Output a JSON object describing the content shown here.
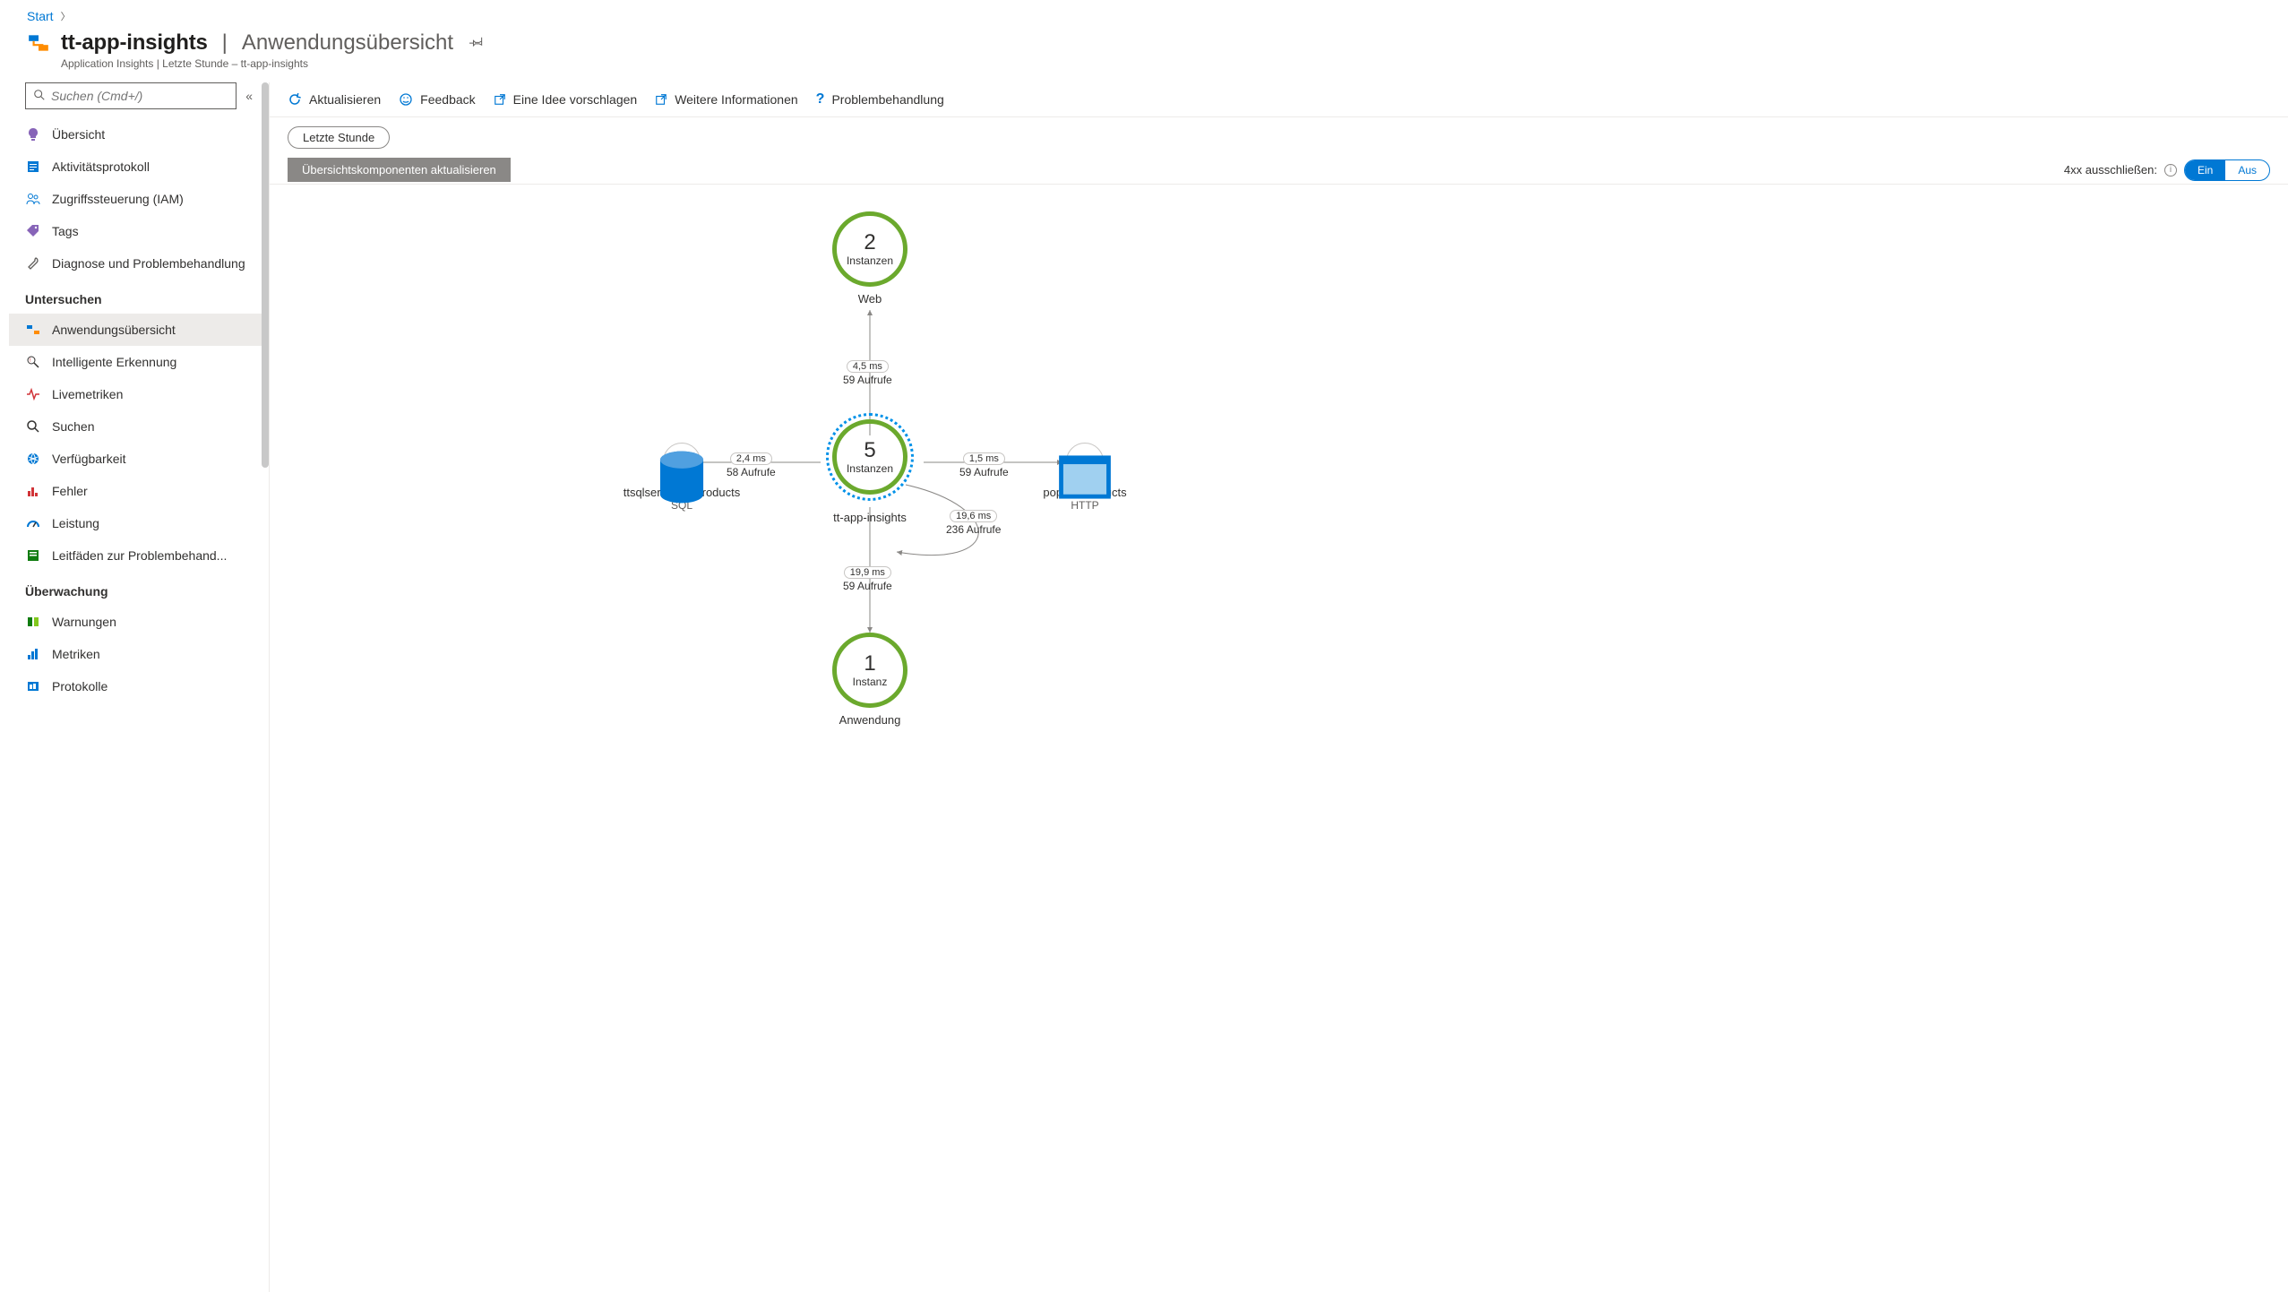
{
  "breadcrumb": {
    "start": "Start"
  },
  "header": {
    "resource_name": "tt-app-insights",
    "page_name": "Anwendungsübersicht",
    "subtitle": "Application Insights | Letzte Stunde – tt-app-insights"
  },
  "search": {
    "placeholder": "Suchen (Cmd+/)"
  },
  "sidebar": {
    "items_top": [
      {
        "label": "Übersicht"
      },
      {
        "label": "Aktivitätsprotokoll"
      },
      {
        "label": "Zugriffssteuerung (IAM)"
      },
      {
        "label": "Tags"
      },
      {
        "label": "Diagnose und Problembehandlung"
      }
    ],
    "group_investigate": "Untersuchen",
    "items_investigate": [
      {
        "label": "Anwendungsübersicht"
      },
      {
        "label": "Intelligente Erkennung"
      },
      {
        "label": "Livemetriken"
      },
      {
        "label": "Suchen"
      },
      {
        "label": "Verfügbarkeit"
      },
      {
        "label": "Fehler"
      },
      {
        "label": "Leistung"
      },
      {
        "label": "Leitfäden zur Problembehand..."
      }
    ],
    "group_monitor": "Überwachung",
    "items_monitor": [
      {
        "label": "Warnungen"
      },
      {
        "label": "Metriken"
      },
      {
        "label": "Protokolle"
      }
    ]
  },
  "toolbar": {
    "refresh": "Aktualisieren",
    "feedback": "Feedback",
    "suggest": "Eine Idee vorschlagen",
    "moreinfo": "Weitere Informationen",
    "troubleshoot": "Problembehandlung"
  },
  "filter": {
    "time_range": "Letzte Stunde"
  },
  "greybar": {
    "update_components": "Übersichtskomponenten aktualisieren",
    "exclude4xx_label": "4xx ausschließen:",
    "toggle_on": "Ein",
    "toggle_off": "Aus"
  },
  "map": {
    "web": {
      "count": "2",
      "unit": "Instanzen",
      "label": "Web"
    },
    "center": {
      "count": "5",
      "unit": "Instanzen",
      "label": "tt-app-insights"
    },
    "app": {
      "count": "1",
      "unit": "Instanz",
      "label": "Anwendung"
    },
    "sql": {
      "label": "ttsqlserver... | products",
      "sublabel": "SQL"
    },
    "http": {
      "label": "popularproducts",
      "sublabel": "HTTP"
    },
    "edge_web_center": {
      "ms": "4,5 ms",
      "calls": "59 Aufrufe"
    },
    "edge_center_sql": {
      "ms": "2,4 ms",
      "calls": "58 Aufrufe"
    },
    "edge_center_http": {
      "ms": "1,5 ms",
      "calls": "59 Aufrufe"
    },
    "edge_center_self": {
      "ms": "19,6 ms",
      "calls": "236 Aufrufe"
    },
    "edge_center_app": {
      "ms": "19,9 ms",
      "calls": "59 Aufrufe"
    }
  }
}
